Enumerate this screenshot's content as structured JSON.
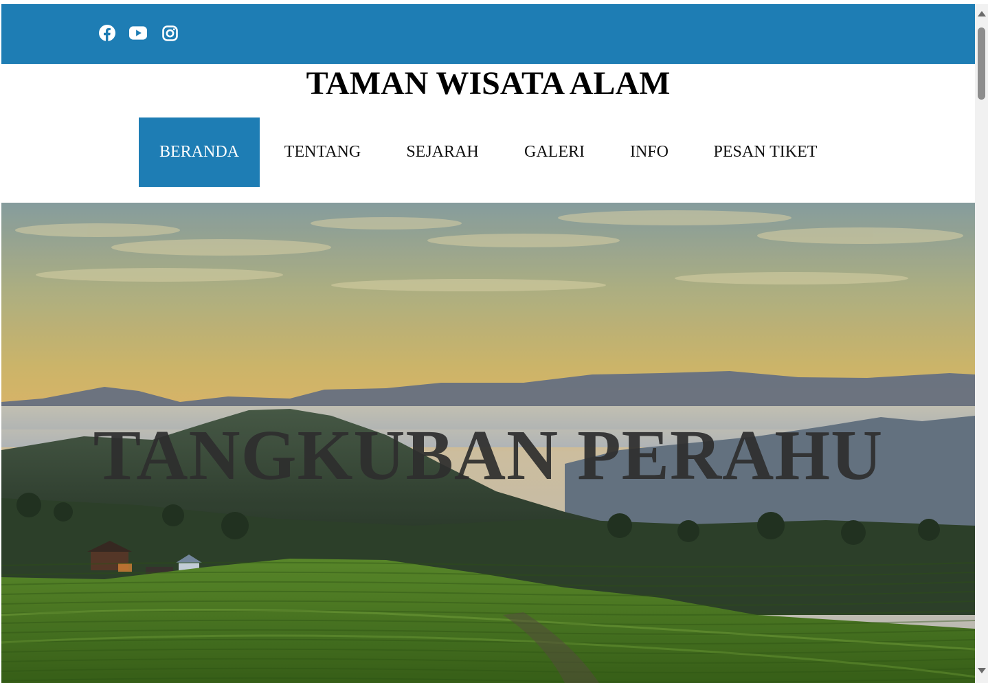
{
  "colors": {
    "accent": "#1e7db4",
    "nav_text": "#111111",
    "hero_title": "#2e2e2e"
  },
  "header": {
    "social": [
      {
        "name": "facebook",
        "icon": "facebook-icon"
      },
      {
        "name": "youtube",
        "icon": "youtube-icon"
      },
      {
        "name": "instagram",
        "icon": "instagram-icon"
      }
    ],
    "title": "TAMAN WISATA ALAM"
  },
  "nav": {
    "items": [
      {
        "label": "BERANDA",
        "active": true
      },
      {
        "label": "TENTANG",
        "active": false
      },
      {
        "label": "SEJARAH",
        "active": false
      },
      {
        "label": "GALERI",
        "active": false
      },
      {
        "label": "INFO",
        "active": false
      },
      {
        "label": "PESAN TIKET",
        "active": false
      }
    ]
  },
  "hero": {
    "title": "TANGKUBAN PERAHU",
    "image": "landscape-photo"
  }
}
